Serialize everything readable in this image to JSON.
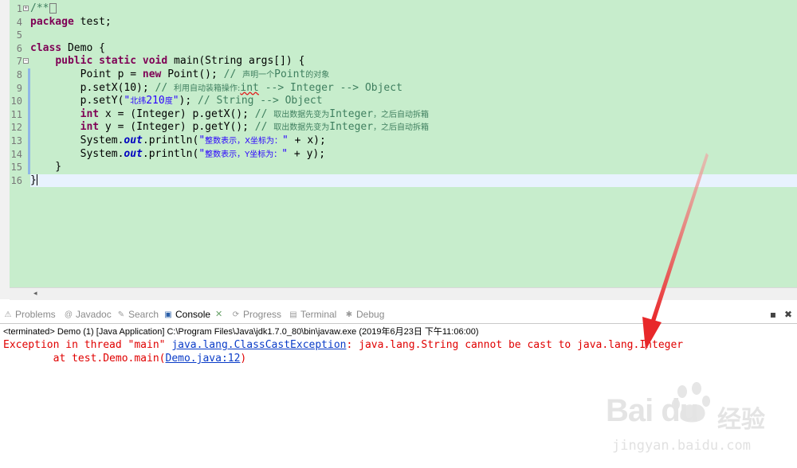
{
  "editor": {
    "lines": [
      {
        "num": "1",
        "tokens": [
          [
            "cm",
            "/**"
          ]
        ],
        "fold": "+",
        "box": true
      },
      {
        "num": "4",
        "tokens": [
          [
            "kw",
            "package"
          ],
          [
            "",
            " test;"
          ]
        ]
      },
      {
        "num": "5",
        "tokens": []
      },
      {
        "num": "6",
        "tokens": [
          [
            "kw",
            "class"
          ],
          [
            "",
            " Demo {"
          ]
        ]
      },
      {
        "num": "7",
        "tokens": [
          [
            "",
            "    "
          ],
          [
            "kw",
            "public"
          ],
          [
            "",
            " "
          ],
          [
            "kw",
            "static"
          ],
          [
            "",
            " "
          ],
          [
            "kw",
            "void"
          ],
          [
            "",
            " main(String args[]) {"
          ]
        ],
        "fold": "−"
      },
      {
        "num": "8",
        "tokens": [
          [
            "",
            "        Point p = "
          ],
          [
            "kw",
            "new"
          ],
          [
            "",
            " Point(); "
          ],
          [
            "cm",
            "// "
          ],
          [
            "cmcjk",
            "声明一个"
          ],
          [
            "cm",
            "Point"
          ],
          [
            "cmcjk",
            "的对象"
          ]
        ],
        "bar": true
      },
      {
        "num": "9",
        "tokens": [
          [
            "",
            "        p.setX(10); "
          ],
          [
            "cm",
            "// "
          ],
          [
            "cmcjk",
            "利用自动装箱操作:"
          ],
          [
            "cmsq",
            "int"
          ],
          [
            "cm",
            " --> Integer --> Object"
          ]
        ],
        "bar": true
      },
      {
        "num": "10",
        "tokens": [
          [
            "",
            "        p.setY("
          ],
          [
            "str",
            "\""
          ],
          [
            "strcjk",
            "北纬"
          ],
          [
            "str",
            "210"
          ],
          [
            "strcjk",
            "度"
          ],
          [
            "str",
            "\""
          ],
          [
            "",
            "); "
          ],
          [
            "cm",
            "// String --> Object"
          ]
        ],
        "bar": true
      },
      {
        "num": "11",
        "tokens": [
          [
            "",
            "        "
          ],
          [
            "kw",
            "int"
          ],
          [
            "",
            " x = (Integer) p.getX(); "
          ],
          [
            "cm",
            "// "
          ],
          [
            "cmcjk",
            "取出数据先变为"
          ],
          [
            "cm",
            "Integer"
          ],
          [
            "cmcjk",
            "，之后自动拆箱"
          ]
        ],
        "bar": true
      },
      {
        "num": "12",
        "tokens": [
          [
            "",
            "        "
          ],
          [
            "kw",
            "int"
          ],
          [
            "",
            " y = (Integer) p.getY(); "
          ],
          [
            "cm",
            "// "
          ],
          [
            "cmcjk",
            "取出数据先变为"
          ],
          [
            "cm",
            "Integer"
          ],
          [
            "cmcjk",
            "，之后自动拆箱"
          ]
        ],
        "bar": true
      },
      {
        "num": "13",
        "tokens": [
          [
            "",
            "        System."
          ],
          [
            "fld",
            "out"
          ],
          [
            "",
            ".println("
          ],
          [
            "str",
            "\""
          ],
          [
            "strcjk",
            "整数表示，X坐标为："
          ],
          [
            "str",
            "\""
          ],
          [
            "",
            " + x);"
          ]
        ],
        "bar": true
      },
      {
        "num": "14",
        "tokens": [
          [
            "",
            "        System."
          ],
          [
            "fld",
            "out"
          ],
          [
            "",
            ".println("
          ],
          [
            "str",
            "\""
          ],
          [
            "strcjk",
            "整数表示，Y坐标为："
          ],
          [
            "str",
            "\""
          ],
          [
            "",
            " + y);"
          ]
        ],
        "bar": true
      },
      {
        "num": "15",
        "tokens": [
          [
            "",
            "    }"
          ]
        ],
        "bar": true
      },
      {
        "num": "16",
        "tokens": [
          [
            "",
            "}"
          ]
        ],
        "current": true,
        "cursor": true
      }
    ]
  },
  "tabs": [
    {
      "label": "Problems",
      "icon": "problems-icon",
      "glyph": "⚠"
    },
    {
      "label": "Javadoc",
      "icon": "javadoc-icon",
      "glyph": "@"
    },
    {
      "label": "Search",
      "icon": "search-icon",
      "glyph": "✎"
    },
    {
      "label": "Console",
      "icon": "console-icon",
      "glyph": "▣",
      "active": true
    },
    {
      "label": "Progress",
      "icon": "progress-icon",
      "glyph": "⟳"
    },
    {
      "label": "Terminal",
      "icon": "terminal-icon",
      "glyph": "▤"
    },
    {
      "label": "Debug",
      "icon": "debug-icon",
      "glyph": "✱"
    }
  ],
  "console": {
    "header": "<terminated> Demo (1) [Java Application] C:\\Program Files\\Java\\jdk1.7.0_80\\bin\\javaw.exe (2019年6月23日 下午11:06:00)",
    "line1_prefix": "Exception in thread \"main\" ",
    "line1_link": "java.lang.ClassCastException",
    "line1_suffix": ": java.lang.String cannot be cast to java.lang.Integer",
    "line2_prefix": "        at test.Demo.main(",
    "line2_link": "Demo.java:12",
    "line2_suffix": ")"
  },
  "watermark": {
    "logo": "Bai  du",
    "chinese": "经验",
    "url": "jingyan.baidu.com"
  },
  "colors": {
    "editor_bg": "#c7edcc",
    "error_red": "#e00000",
    "link_blue": "#0a3cc8",
    "arrow_red": "#e8282a"
  }
}
